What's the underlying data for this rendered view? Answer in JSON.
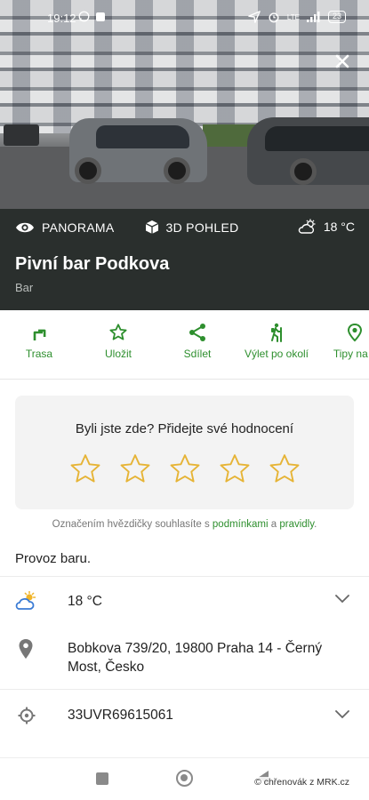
{
  "status_bar": {
    "time": "19:12",
    "network": "LTE",
    "battery": "23",
    "icons": [
      "whatsapp-icon",
      "square-notification-icon",
      "location-arrow-icon",
      "alarm-icon",
      "signal-icon",
      "battery-icon"
    ]
  },
  "photo": {
    "close_icon": "close-icon"
  },
  "panel": {
    "panorama_label": "PANORAMA",
    "view3d_label": "3D POHLED",
    "weather_temp": "18 °C",
    "title": "Pivní bar Podkova",
    "category": "Bar"
  },
  "actions": [
    {
      "label": "Trasa",
      "icon": "route-icon"
    },
    {
      "label": "Uložit",
      "icon": "star-outline-icon"
    },
    {
      "label": "Sdílet",
      "icon": "share-icon"
    },
    {
      "label": "Výlet po okolí",
      "icon": "hiker-icon"
    },
    {
      "label": "Tipy na v",
      "icon": "pin-icon"
    }
  ],
  "rating": {
    "prompt": "Byli jste zde? Přidejte své hodnocení",
    "stars_count": 5,
    "terms_prefix": "Označením hvězdičky souhlasíte s ",
    "terms_link1": "podmínkami",
    "terms_middle": " a ",
    "terms_link2": "pravidly",
    "terms_suffix": "."
  },
  "description": "Provoz baru.",
  "info": {
    "weather": "18 °C",
    "address": "Bobkova 739/20, 19800 Praha 14 - Černý Most, Česko",
    "coordinates": "33UVR69615061"
  },
  "watermark": "© chřenovák z MRK.cz",
  "colors": {
    "accent": "#2e8f2e",
    "panel_bg": "#2a2f2d",
    "star": "#e6b436"
  }
}
